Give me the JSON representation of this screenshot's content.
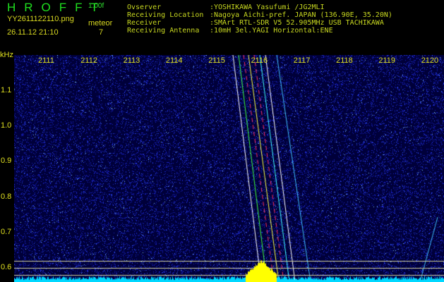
{
  "header": {
    "app_title": "HROFFT",
    "version": "1.00f",
    "filename": "YY2611122110.png",
    "datetime": "26.11.12 21:10",
    "meteor_label": "meteor",
    "meteor_count": "7"
  },
  "info": [
    {
      "label": "Ovserver",
      "value": ":YOSHIKAWA Yasufumi /JG2MLI"
    },
    {
      "label": "Receiving Location",
      "value": ":Nagoya Aichi-pref. JAPAN (136.90E, 35.20N)"
    },
    {
      "label": "Receiver",
      "value": ":SMArt RTL-SDR V5 52.905MHz USB TACHIKAWA"
    },
    {
      "label": "Receiving Antenna",
      "value": ":10mH 3el.YAGI Horizontal:ENE"
    }
  ],
  "axis": {
    "unit": "kHz",
    "y_ticks": [
      "1.1",
      "1.0",
      "0.9",
      "0.8",
      "0.7",
      "0.6"
    ],
    "x_ticks": [
      "2111",
      "2112",
      "2113",
      "2114",
      "2115",
      "2116",
      "2117",
      "2118",
      "2119",
      "2120"
    ]
  },
  "colors": {
    "background": "#00003a",
    "noise": "#2a3cff",
    "meteor": "#ff3060",
    "signal": "#ffff00",
    "baseline": "#00d8ff"
  }
}
